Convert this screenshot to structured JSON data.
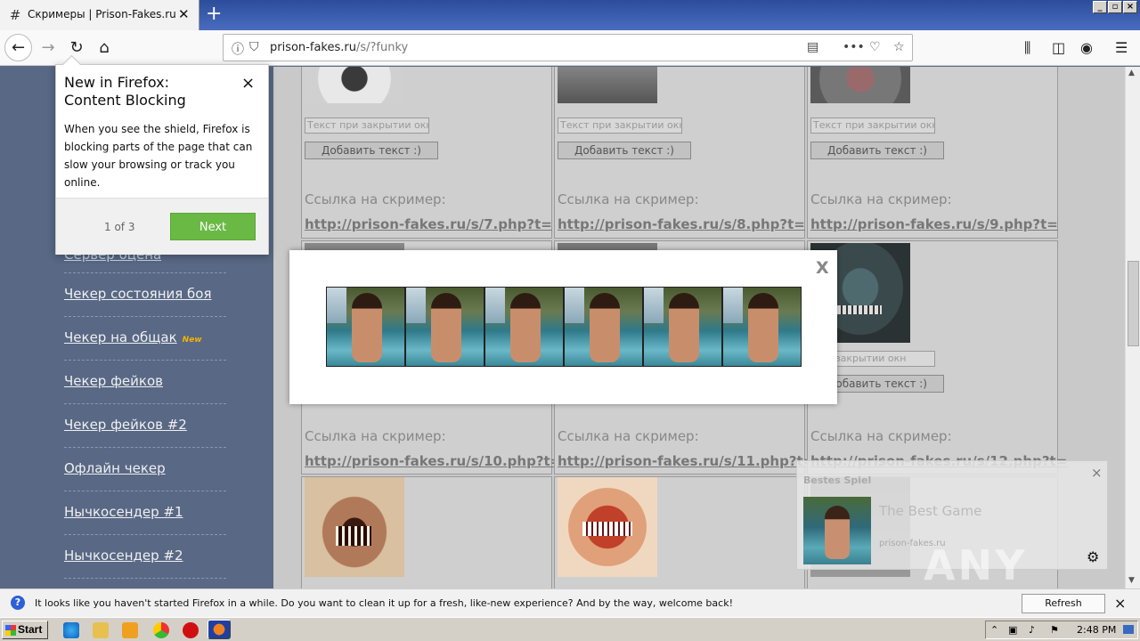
{
  "browser": {
    "tab_title": "Скримеры | Prison-Fakes.ru",
    "url_host": "prison-fakes.ru",
    "url_path": "/s/?funky"
  },
  "sidebar": {
    "items": [
      {
        "label": "Чекер состояния боя",
        "badge": ""
      },
      {
        "label": "Чекер на общак",
        "badge": "New"
      },
      {
        "label": "Чекер фейков",
        "badge": ""
      },
      {
        "label": "Чекер фейков #2",
        "badge": ""
      },
      {
        "label": "Офлайн чекер",
        "badge": ""
      },
      {
        "label": "Нычкосендер #1",
        "badge": ""
      },
      {
        "label": "Нычкосендер #2",
        "badge": ""
      }
    ]
  },
  "grid": {
    "input_placeholder": "Текст при закрытии окна",
    "button_label": "Добавить текст :)",
    "caption": "Ссылка на скример:",
    "links": [
      "http://prison-fakes.ru/s/7.php?t=",
      "http://prison-fakes.ru/s/8.php?t=",
      "http://prison-fakes.ru/s/9.php?t=",
      "http://prison-fakes.ru/s/10.php?t=",
      "http://prison-fakes.ru/s/11.php?t=",
      "http://prison-fakes.ru/s/12.php?t="
    ],
    "partial_input_text": "при закрытии окн",
    "partial_button_text": "Добавить текст :)"
  },
  "modal": {
    "close_label": "X",
    "image_count": 6
  },
  "popup": {
    "title": "New in Firefox: Content Blocking",
    "body": "When you see the shield, Firefox is blocking parts of the page that can slow your browsing or track you online.",
    "counter": "1 of 3",
    "next_label": "Next",
    "close_label": "×"
  },
  "ad": {
    "header": "Bestes Spiel",
    "title": "The Best Game",
    "source": "prison-fakes.ru",
    "close_label": "×"
  },
  "watermark": "ANY RUN",
  "notification": {
    "text": "It looks like you haven't started Firefox in a while. Do you want to clean it up for a fresh, like-new experience? And by the way, welcome back!",
    "button_label": "Refresh Firefox…",
    "close_label": "×"
  },
  "taskbar": {
    "start_label": "Start",
    "clock": "2:48 PM"
  },
  "colors": {
    "accent_next": "#6ab944",
    "page_bg": "#576783",
    "badge_new": "#f2b400"
  }
}
